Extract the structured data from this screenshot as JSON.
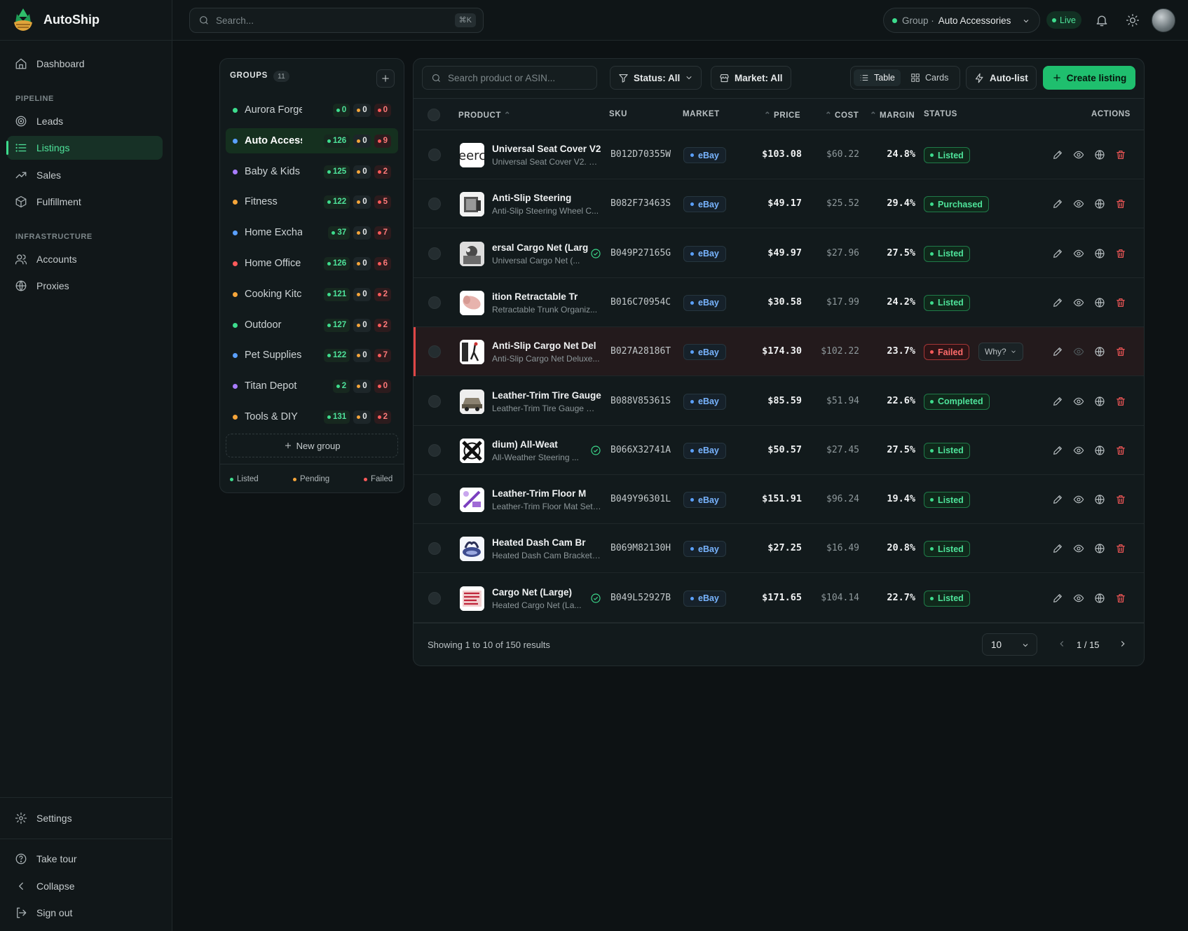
{
  "app": {
    "name": "AutoShip"
  },
  "sidebar": {
    "items": [
      {
        "label": "Dashboard",
        "icon": "home-icon"
      },
      {
        "label": "Leads",
        "icon": "target-icon"
      },
      {
        "label": "Listings",
        "icon": "list-icon",
        "active": true
      },
      {
        "label": "Sales",
        "icon": "trending-up-icon"
      },
      {
        "label": "Fulfillment",
        "icon": "package-icon"
      },
      {
        "label": "Accounts",
        "icon": "users-icon"
      },
      {
        "label": "Proxies",
        "icon": "globe-icon"
      }
    ],
    "sections": {
      "pipeline": "PIPELINE",
      "infrastructure": "INFRASTRUCTURE"
    },
    "bottom": {
      "settings": "Settings",
      "tour": "Take tour",
      "collapse": "Collapse",
      "signout": "Sign out"
    }
  },
  "topbar": {
    "search_placeholder": "Search...",
    "shortcut": "⌘K",
    "group_prefix": "Group ·",
    "group_name": "Auto Accessories",
    "live": "Live"
  },
  "groups": {
    "title": "GROUPS",
    "count": "11",
    "items": [
      {
        "name": "Aurora Forge",
        "color": "#3ddc8d",
        "listed": "0",
        "pending": "0",
        "failed": "0"
      },
      {
        "name": "Auto Accessories",
        "color": "#5aa0ff",
        "listed": "126",
        "pending": "0",
        "failed": "9",
        "active": true
      },
      {
        "name": "Baby & Kids",
        "color": "#a87cff",
        "listed": "125",
        "pending": "0",
        "failed": "2"
      },
      {
        "name": "Fitness",
        "color": "#f5a53a",
        "listed": "122",
        "pending": "0",
        "failed": "5"
      },
      {
        "name": "Home Exchange",
        "color": "#5aa0ff",
        "listed": "37",
        "pending": "0",
        "failed": "7"
      },
      {
        "name": "Home Office",
        "color": "#ff5a5a",
        "listed": "126",
        "pending": "0",
        "failed": "6"
      },
      {
        "name": "Cooking Kitchen",
        "color": "#f5a53a",
        "listed": "121",
        "pending": "0",
        "failed": "2"
      },
      {
        "name": "Outdoor",
        "color": "#3ddc8d",
        "listed": "127",
        "pending": "0",
        "failed": "2"
      },
      {
        "name": "Pet Supplies",
        "color": "#5aa0ff",
        "listed": "122",
        "pending": "0",
        "failed": "7"
      },
      {
        "name": "Titan Depot",
        "color": "#a87cff",
        "listed": "2",
        "pending": "0",
        "failed": "0"
      },
      {
        "name": "Tools & DIY",
        "color": "#f5a53a",
        "listed": "131",
        "pending": "0",
        "failed": "2"
      }
    ],
    "new_group": "New group",
    "legend": {
      "listed": "Listed",
      "pending": "Pending",
      "failed": "Failed"
    }
  },
  "toolbar": {
    "search_placeholder": "Search product or ASIN...",
    "status_filter": "Status: All",
    "market_filter": "Market: All",
    "view_table": "Table",
    "view_cards": "Cards",
    "autolist": "Auto-list",
    "create": "Create listing"
  },
  "table": {
    "columns": {
      "product": "PRODUCT",
      "sku": "SKU",
      "market": "MARKET",
      "price": "PRICE",
      "cost": "COST",
      "margin": "MARGIN",
      "status": "STATUS",
      "actions": "ACTIONS"
    },
    "rows": [
      {
        "name": "Universal Seat Cover V2",
        "sub": "Universal Seat Cover V2. B...",
        "sku": "B012D70355W",
        "market": "eBay",
        "price": "$103.08",
        "cost": "$60.22",
        "margin": "24.8%",
        "status": "Listed",
        "tone": "green",
        "verified": false,
        "thumb": "text"
      },
      {
        "name": "Anti-Slip Steering",
        "sub": "Anti-Slip Steering Wheel C...",
        "sku": "B082F73463S",
        "market": "eBay",
        "price": "$49.17",
        "cost": "$25.52",
        "margin": "29.4%",
        "status": "Purchased",
        "tone": "green",
        "verified": false,
        "thumb": "box"
      },
      {
        "name": "ersal Cargo Net (Larg",
        "sub": "Universal Cargo Net (...",
        "sku": "B049P27165G",
        "market": "eBay",
        "price": "$49.97",
        "cost": "$27.96",
        "margin": "27.5%",
        "status": "Listed",
        "tone": "green",
        "verified": true,
        "thumb": "photo"
      },
      {
        "name": "ition Retractable Tr",
        "sub": "Retractable Trunk Organiz...",
        "sku": "B016C70954C",
        "market": "eBay",
        "price": "$30.58",
        "cost": "$17.99",
        "margin": "24.2%",
        "status": "Listed",
        "tone": "green",
        "verified": false,
        "thumb": "pink"
      },
      {
        "name": "Anti-Slip Cargo Net Del",
        "sub": "Anti-Slip Cargo Net Deluxe...",
        "sku": "B027A28186T",
        "market": "eBay",
        "price": "$174.30",
        "cost": "$102.22",
        "margin": "23.7%",
        "status": "Failed",
        "tone": "red",
        "verified": false,
        "thumb": "figure",
        "why": "Why?"
      },
      {
        "name": "Leather-Trim Tire Gauge –",
        "sub": "Leather-Trim Tire Gauge — ...",
        "sku": "B088V85361S",
        "market": "eBay",
        "price": "$85.59",
        "cost": "$51.94",
        "margin": "22.6%",
        "status": "Completed",
        "tone": "green",
        "verified": false,
        "thumb": "car"
      },
      {
        "name": "dium) All-Weat",
        "sub": "All-Weather Steering ...",
        "sku": "B066X32741A",
        "market": "eBay",
        "price": "$50.57",
        "cost": "$27.45",
        "margin": "27.5%",
        "status": "Listed",
        "tone": "green",
        "verified": true,
        "thumb": "cross"
      },
      {
        "name": "Leather-Trim Floor M",
        "sub": "Leather-Trim Floor Mat Set ...",
        "sku": "B049Y96301L",
        "market": "eBay",
        "price": "$151.91",
        "cost": "$96.24",
        "margin": "19.4%",
        "status": "Listed",
        "tone": "green",
        "verified": false,
        "thumb": "purple"
      },
      {
        "name": "Heated Dash Cam Br",
        "sub": "Heated Dash Cam Bracket ...",
        "sku": "B069M82130H",
        "market": "eBay",
        "price": "$27.25",
        "cost": "$16.49",
        "margin": "20.8%",
        "status": "Listed",
        "tone": "green",
        "verified": false,
        "thumb": "blue"
      },
      {
        "name": "Cargo Net (Large)",
        "sub": "Heated Cargo Net (La...",
        "sku": "B049L52927B",
        "market": "eBay",
        "price": "$171.65",
        "cost": "$104.14",
        "margin": "22.7%",
        "status": "Listed",
        "tone": "green",
        "verified": true,
        "thumb": "red"
      }
    ]
  },
  "pagination": {
    "summary": "Showing 1 to 10 of 150 results",
    "per_page": "10",
    "page": "1 / 15"
  },
  "colors": {
    "accent": "#1fbf6e",
    "listed": "#3ddc8d",
    "pending": "#f5a53a",
    "failed": "#ff5a5a",
    "market": "#5aa0ff"
  }
}
